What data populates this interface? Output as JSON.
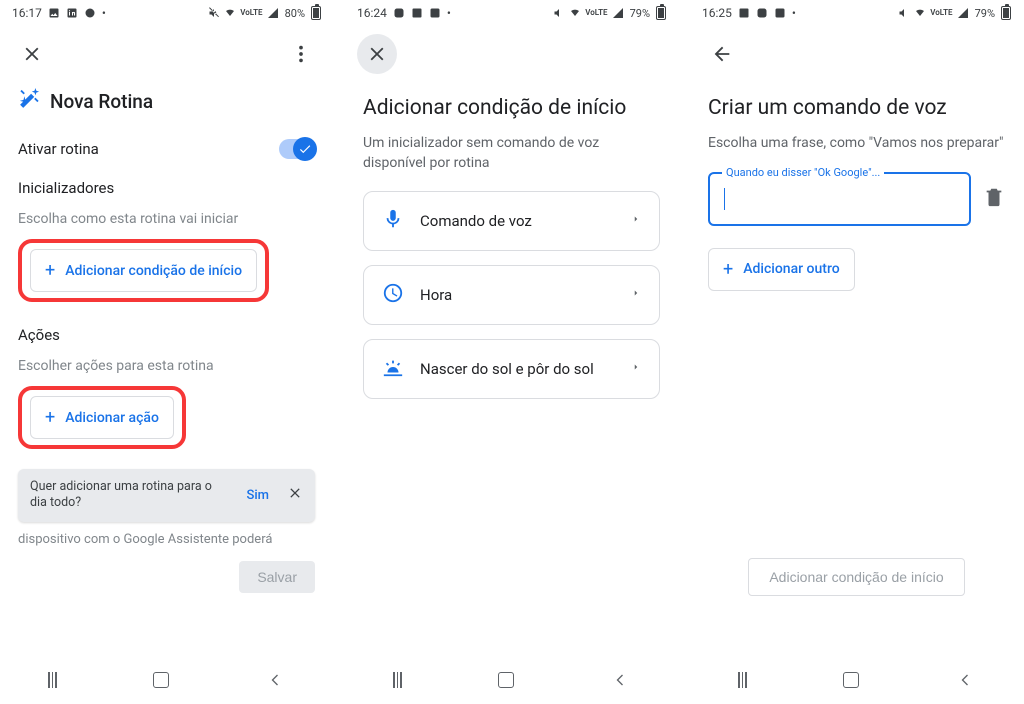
{
  "screen1": {
    "status": {
      "time": "16:17",
      "battery": "80%"
    },
    "title": "Nova Rotina",
    "activate_label": "Ativar rotina",
    "initializers_label": "Inicializadores",
    "initializers_hint": "Escolha como esta rotina vai iniciar",
    "add_start_condition": "Adicionar condição de início",
    "actions_label": "Ações",
    "actions_hint": "Escolher ações para esta rotina",
    "add_action": "Adicionar ação",
    "snackbar_msg": "Quer adicionar uma rotina para o dia todo?",
    "snackbar_yes": "Sim",
    "shadow_text": "dispositivo com o Google Assistente poderá",
    "save": "Salvar"
  },
  "screen2": {
    "status": {
      "time": "16:24",
      "battery": "79%"
    },
    "heading": "Adicionar condição de início",
    "subtitle": "Um inicializador sem comando de voz disponível por rotina",
    "options": [
      {
        "label": "Comando de voz",
        "icon": "mic"
      },
      {
        "label": "Hora",
        "icon": "clock"
      },
      {
        "label": "Nascer do sol e pôr do sol",
        "icon": "sun"
      }
    ]
  },
  "screen3": {
    "status": {
      "time": "16:25",
      "battery": "79%"
    },
    "heading": "Criar um comando de voz",
    "subtitle": "Escolha uma frase, como \"Vamos nos preparar\"",
    "field_label": "Quando eu disser \"Ok Google\"...",
    "add_another": "Adicionar outro",
    "footer_btn": "Adicionar condição de início"
  }
}
